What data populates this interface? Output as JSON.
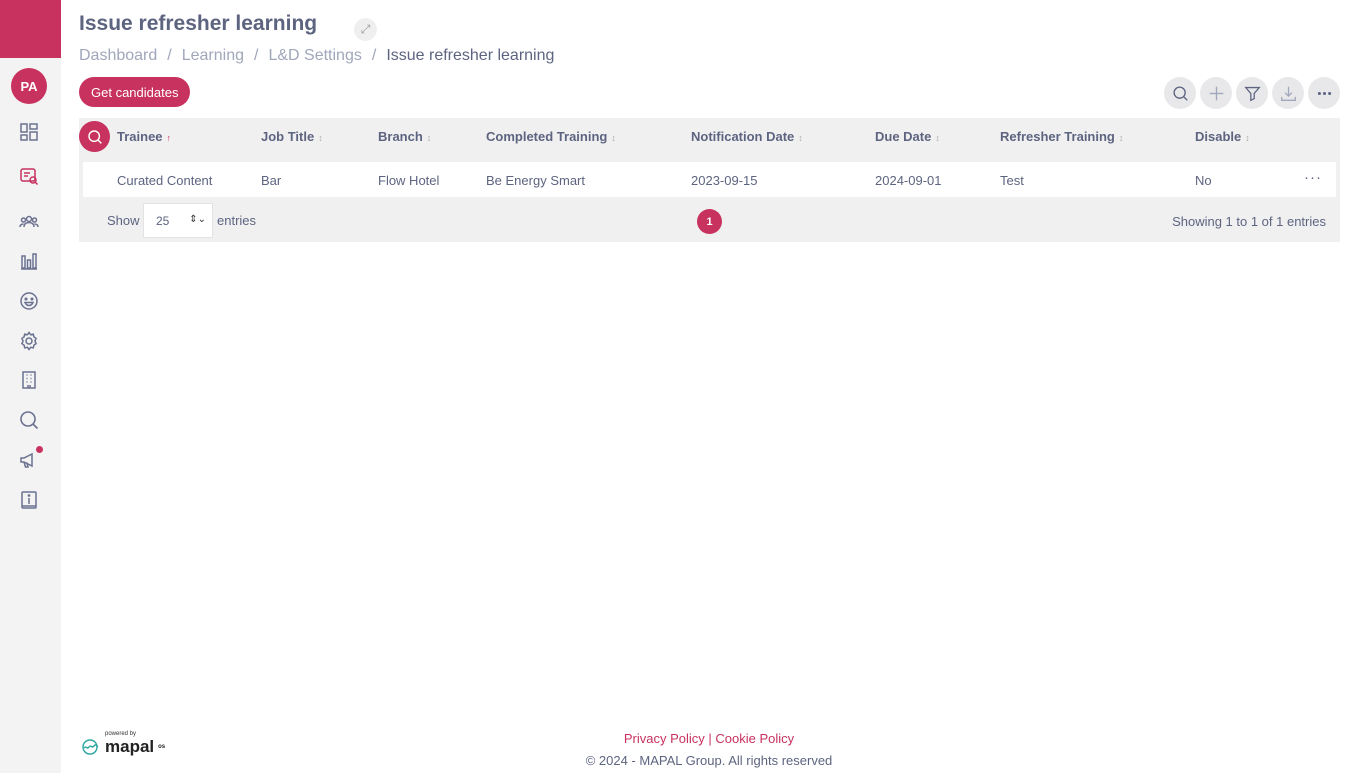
{
  "sidebar": {
    "avatar_initials": "PA",
    "icons": [
      "dashboard-icon",
      "learning-search-icon",
      "people-icon",
      "reports-chart-icon",
      "smiley-icon",
      "gear-icon",
      "building-icon",
      "search-icon",
      "megaphone-icon",
      "info-icon"
    ]
  },
  "header": {
    "title": "Issue refresher learning",
    "breadcrumb": [
      "Dashboard",
      "Learning",
      "L&D Settings",
      "Issue refresher learning"
    ],
    "separator": "/"
  },
  "actions": {
    "get_candidates": "Get candidates",
    "toolbar_icons": [
      "search-icon",
      "plus-icon",
      "filter-icon",
      "download-icon",
      "more-icon"
    ]
  },
  "table": {
    "columns": [
      "Trainee",
      "Job Title",
      "Branch",
      "Completed Training",
      "Notification Date",
      "Due Date",
      "Refresher Training",
      "Disable"
    ],
    "rows": [
      [
        "Curated Content",
        "Bar",
        "Flow Hotel",
        "Be Energy Smart",
        "2023-09-15",
        "2024-09-01",
        "Test",
        "No"
      ]
    ],
    "row_more": "···",
    "show_label": "Show",
    "entries_value": "25",
    "entries_label": "entries",
    "current_page": "1",
    "showing_text": "Showing 1 to 1 of 1 entries"
  },
  "footer": {
    "powered_by": "powered by",
    "brand": "mapal",
    "brand_sup": "os",
    "privacy": "Privacy Policy",
    "link_sep": " | ",
    "cookie": "Cookie Policy",
    "copyright": "© 2024 - MAPAL Group. All rights reserved"
  },
  "colors": {
    "accent": "#c8325f",
    "text": "#5d6480",
    "muted": "#a0a7ba"
  }
}
